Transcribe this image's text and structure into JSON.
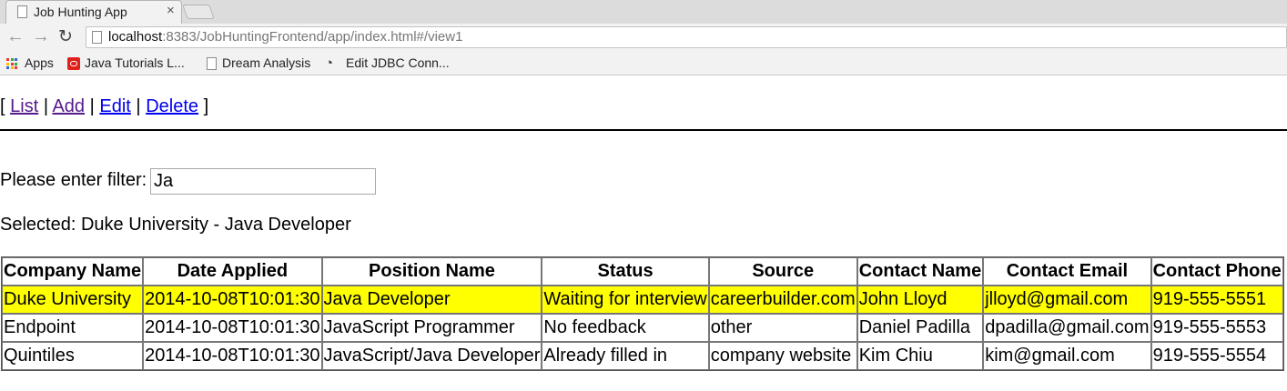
{
  "browser": {
    "tab_title": "Job Hunting App",
    "tab_close": "×",
    "url_host": "localhost",
    "url_rest": ":8383/JobHuntingFrontend/app/index.html#/view1",
    "back": "←",
    "forward": "→",
    "reload": "↻",
    "bookmarks": {
      "apps": "Apps",
      "java_tutorials": "Java Tutorials L...",
      "dream_analysis": "Dream Analysis",
      "edit_jdbc": "Edit JDBC Conn..."
    }
  },
  "nav": {
    "open": "[",
    "sep": "|",
    "close": "]",
    "list": "List",
    "add": "Add",
    "edit": "Edit",
    "delete": "Delete"
  },
  "filter": {
    "label": "Please enter filter:",
    "value": "Ja"
  },
  "selected": {
    "text": "Selected: Duke University - Java Developer"
  },
  "table": {
    "headers": [
      "Company Name",
      "Date Applied",
      "Position Name",
      "Status",
      "Source",
      "Contact Name",
      "Contact Email",
      "Contact Phone"
    ],
    "rows": [
      [
        "Duke University",
        "2014-10-08T10:01:30",
        "Java Developer",
        "Waiting for interview",
        "careerbuilder.com",
        "John Lloyd",
        "jlloyd@gmail.com",
        "919-555-5551"
      ],
      [
        "Endpoint",
        "2014-10-08T10:01:30",
        "JavaScript Programmer",
        "No feedback",
        "other",
        "Daniel Padilla",
        "dpadilla@gmail.com",
        "919-555-5553"
      ],
      [
        "Quintiles",
        "2014-10-08T10:01:30",
        "JavaScript/Java Developer",
        "Already filled in",
        "company website",
        "Kim Chiu",
        "kim@gmail.com",
        "919-555-5554"
      ]
    ],
    "selected_row_color": "#ffff00"
  }
}
